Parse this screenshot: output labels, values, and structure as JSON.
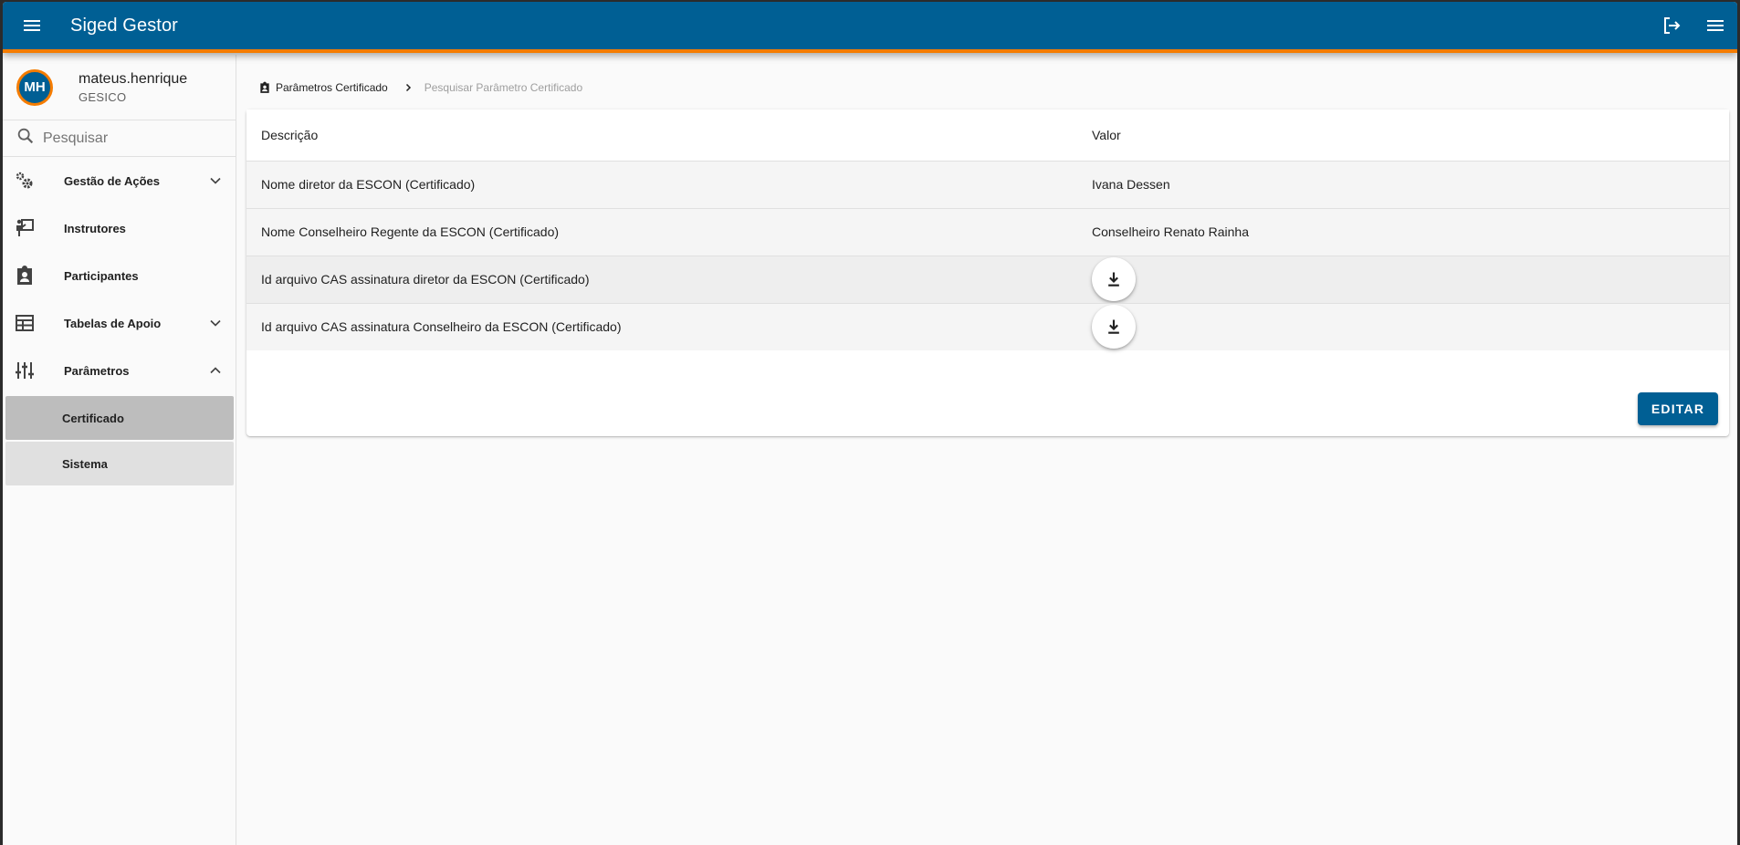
{
  "app": {
    "title": "Siged Gestor"
  },
  "colors": {
    "primary": "#005f94",
    "accent": "#f57c00"
  },
  "header_icons": {
    "menu_left": "menu-icon",
    "logout": "logout-icon",
    "menu_right": "menu-icon"
  },
  "user": {
    "initials": "MH",
    "name": "mateus.henrique",
    "org": "GESICO"
  },
  "search": {
    "placeholder": "Pesquisar"
  },
  "sidebar": {
    "items": [
      {
        "label": "Gestão de Ações",
        "icon": "gears-icon",
        "expandable": true,
        "expanded": false
      },
      {
        "label": "Instrutores",
        "icon": "instructor-icon"
      },
      {
        "label": "Participantes",
        "icon": "badge-icon"
      },
      {
        "label": "Tabelas de Apoio",
        "icon": "table-icon",
        "expandable": true,
        "expanded": false
      },
      {
        "label": "Parâmetros",
        "icon": "sliders-icon",
        "expandable": true,
        "expanded": true
      }
    ],
    "sub_items": [
      {
        "label": "Certificado",
        "active": true
      },
      {
        "label": "Sistema",
        "active": false
      }
    ]
  },
  "breadcrumb": {
    "first": "Parâmetros Certificado",
    "second": "Pesquisar Parâmetro Certificado"
  },
  "table": {
    "headers": {
      "description": "Descrição",
      "value": "Valor"
    },
    "rows": [
      {
        "description": "Nome diretor da ESCON (Certificado)",
        "value": "Ivana Dessen"
      },
      {
        "description": "Nome Conselheiro Regente da ESCON (Certificado)",
        "value": "Conselheiro Renato Rainha"
      },
      {
        "description": "Id arquivo CAS assinatura diretor da ESCON (Certificado)",
        "value_icon": "download-icon"
      },
      {
        "description": "Id arquivo CAS assinatura Conselheiro da ESCON (Certificado)",
        "value_icon": "download-icon"
      }
    ]
  },
  "actions": {
    "edit_label": "EDITAR"
  }
}
